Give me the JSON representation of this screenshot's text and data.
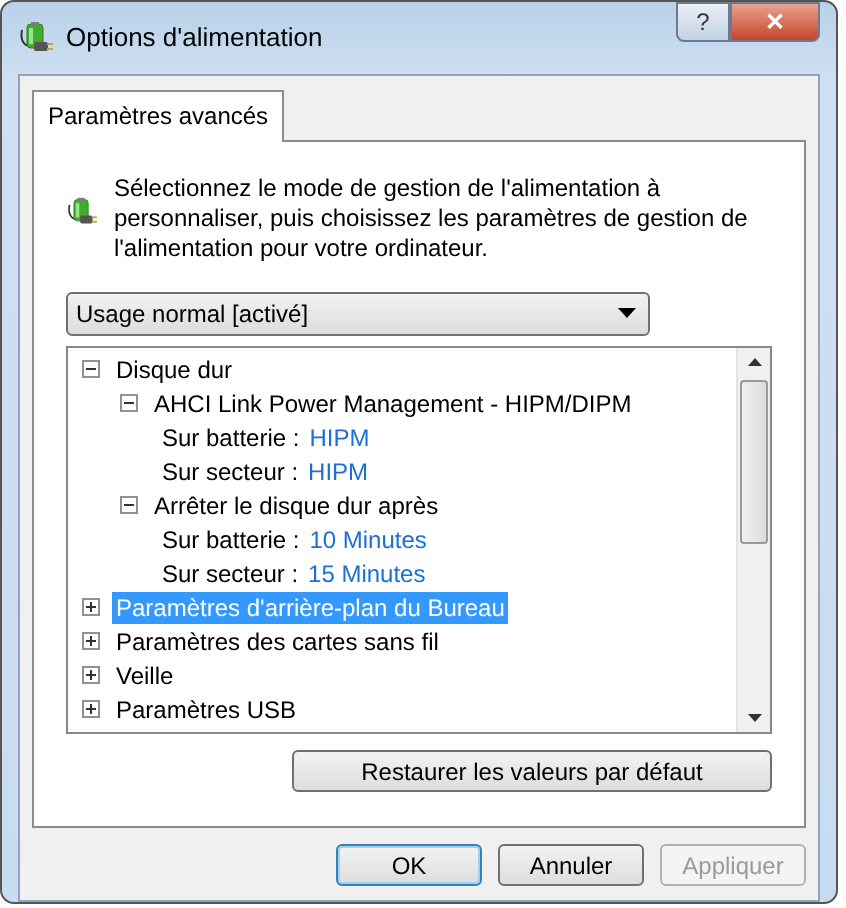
{
  "window": {
    "title": "Options d'alimentation",
    "buttons": [
      "?",
      "✕"
    ]
  },
  "tabs": [
    {
      "label": "Paramètres avancés",
      "selected": true
    }
  ],
  "description": "Sélectionnez le mode de gestion de l'alimentation à personnaliser, puis choisissez les paramètres de gestion de l'alimentation pour votre ordinateur.",
  "plan_select": {
    "value": "Usage normal [activé]"
  },
  "tree": {
    "items": [
      {
        "label": "Disque dur",
        "expanded": true,
        "selected": false,
        "children": [
          {
            "label": "AHCI Link Power Management - HIPM/DIPM",
            "expanded": true,
            "selected": false,
            "children": [
              {
                "label": "Sur batterie :",
                "value": "HIPM"
              },
              {
                "label": "Sur secteur :",
                "value": "HIPM"
              }
            ]
          },
          {
            "label": "Arrêter le disque dur après",
            "expanded": true,
            "selected": false,
            "children": [
              {
                "label": "Sur batterie :",
                "value": "10 Minutes"
              },
              {
                "label": "Sur secteur :",
                "value": "15 Minutes"
              }
            ]
          }
        ]
      },
      {
        "label": "Paramètres d'arrière-plan du Bureau",
        "expanded": false,
        "selected": true
      },
      {
        "label": "Paramètres des cartes sans fil",
        "expanded": false,
        "selected": false
      },
      {
        "label": "Veille",
        "expanded": false,
        "selected": false
      },
      {
        "label": "Paramètres USB",
        "expanded": false,
        "selected": false
      }
    ]
  },
  "restore_button": "Restaurer les valeurs par défaut",
  "buttons": [
    {
      "label": "OK",
      "disabled": false
    },
    {
      "label": "Annuler",
      "disabled": false
    },
    {
      "label": "Appliquer",
      "disabled": true
    }
  ]
}
